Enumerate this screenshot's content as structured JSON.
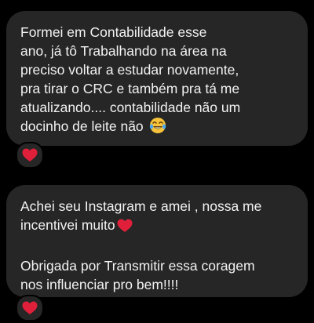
{
  "messages": [
    {
      "lines": [
        "Formei em Contabilidade esse",
        "ano, já tô Trabalhando na área na",
        "preciso voltar a estudar novamente,",
        "pra tirar o CRC e também pra tá me",
        "atualizando.... contabilidade não um",
        "docinho de leite não"
      ],
      "trailing_emoji": "face-with-tears-of-joy-icon",
      "reaction": "red-heart-icon"
    },
    {
      "lines": [
        "Achei seu Instagram e amei , nossa me",
        "incentivei muito"
      ],
      "inline_emoji": "red-heart-icon",
      "lines_after_gap": [
        "Obrigada por Transmitir essa coragem",
        "nos influenciar pro bem!!!!"
      ],
      "reaction": "red-heart-icon"
    }
  ],
  "colors": {
    "background": "#000000",
    "bubble": "#262626",
    "text": "#f2f2f2",
    "heart": "#e0203a",
    "emoji_face": "#f6c33b"
  }
}
